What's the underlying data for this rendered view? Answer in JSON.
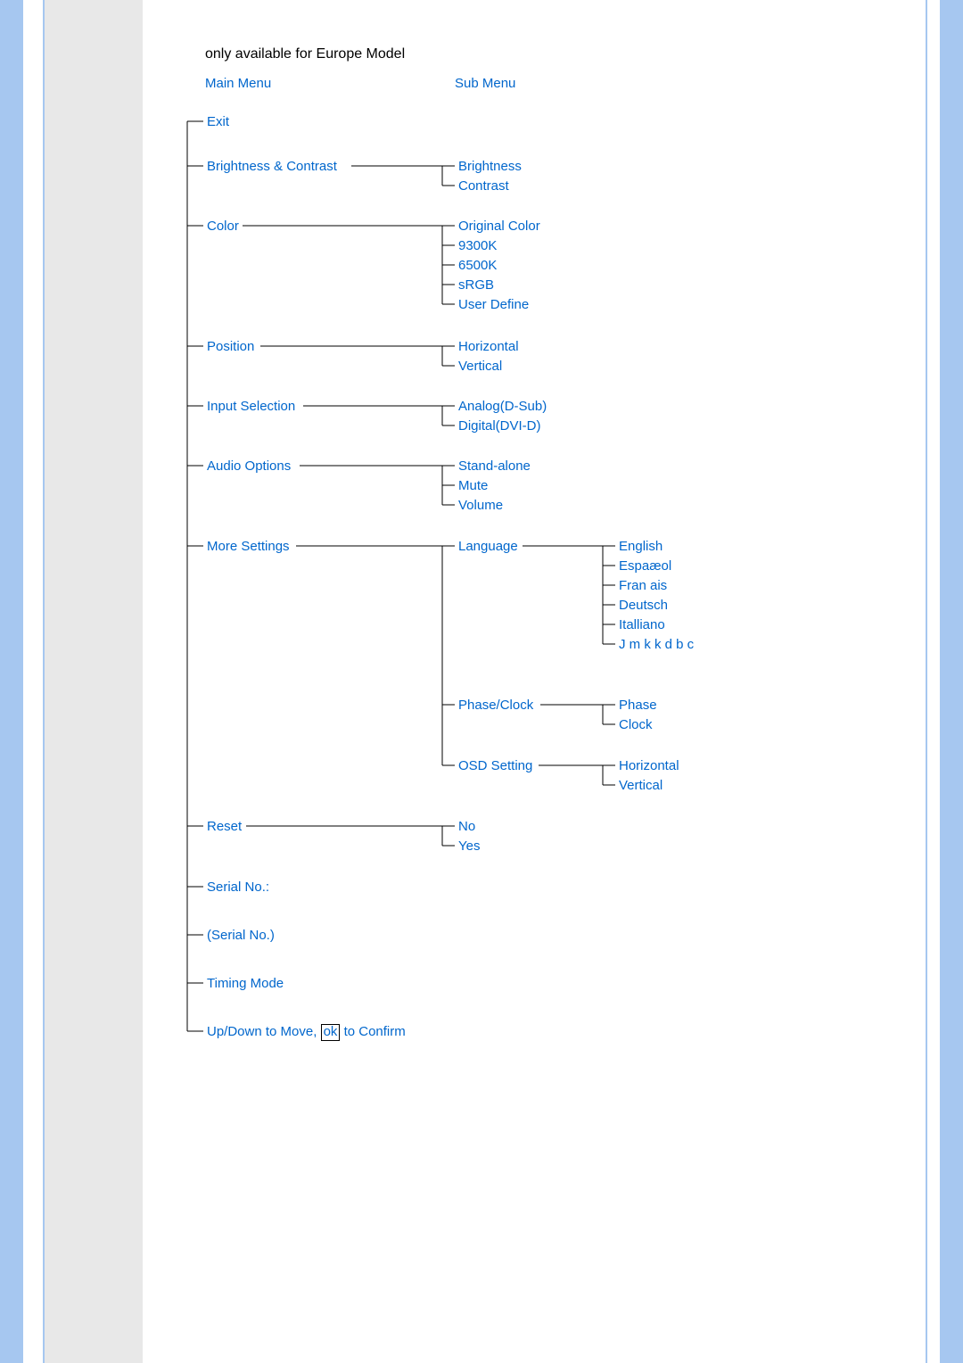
{
  "note": "only available for Europe Model",
  "headers": {
    "main": "Main Menu",
    "sub": "Sub Menu"
  },
  "main": {
    "exit": "Exit",
    "brightness_contrast": "Brightness & Contrast",
    "color": "Color",
    "position": "Position",
    "input_selection": "Input Selection",
    "audio_options": "Audio Options",
    "more_settings": "More Settings",
    "reset": "Reset",
    "serial_no_label": "Serial No.:",
    "serial_no_value": "(Serial No.)",
    "timing_mode": "Timing Mode",
    "instruction_prefix": "Up/Down to Move, ",
    "instruction_ok": "ok",
    "instruction_suffix": " to Confirm"
  },
  "sub": {
    "brightness": "Brightness",
    "contrast": "Contrast",
    "original_color": "Original Color",
    "c9300k": "9300K",
    "c6500k": "6500K",
    "srgb": "sRGB",
    "user_define": "User Define",
    "horizontal": "Horizontal",
    "vertical": "Vertical",
    "analog": "Analog(D-Sub)",
    "digital": "Digital(DVI-D)",
    "stand_alone": "Stand-alone",
    "mute": "Mute",
    "volume": "Volume",
    "language": "Language",
    "phase_clock": "Phase/Clock",
    "osd_setting": "OSD Setting",
    "no": "No",
    "yes": "Yes"
  },
  "third": {
    "english": "English",
    "espanol": "Espaæol",
    "francais": "Fran ais",
    "deutsch": "Deutsch",
    "italiano": "Italliano",
    "japanese": "J m k k d b c",
    "phase": "Phase",
    "clock": "Clock",
    "osd_horizontal": "Horizontal",
    "osd_vertical": "Vertical"
  }
}
